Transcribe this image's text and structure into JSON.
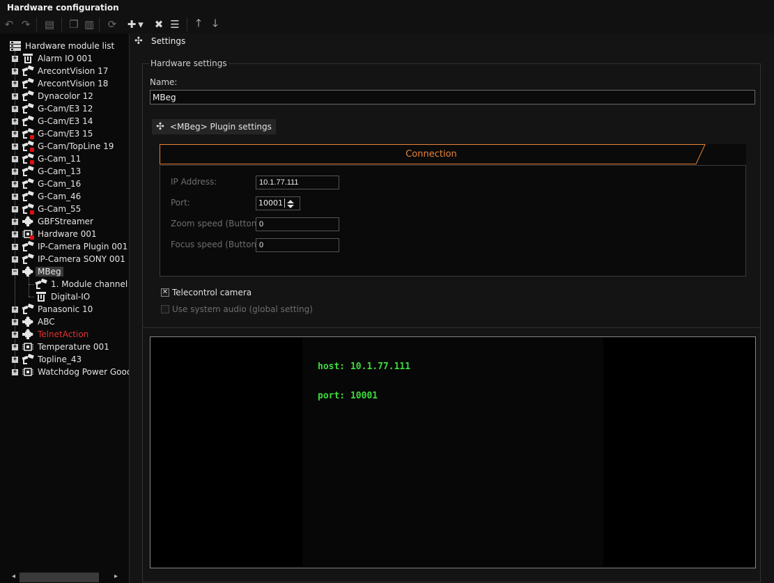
{
  "window": {
    "title": "Hardware configuration"
  },
  "toolbar": {
    "buttons": [
      {
        "icon": "undo-icon",
        "glyph": "↶"
      },
      {
        "icon": "redo-icon",
        "glyph": "↷"
      },
      {
        "icon": "print-icon",
        "glyph": "▤"
      },
      {
        "icon": "copy-icon",
        "glyph": "❐"
      },
      {
        "icon": "paste-icon",
        "glyph": "▥"
      },
      {
        "icon": "refresh-icon",
        "glyph": "⟳"
      },
      {
        "icon": "add-module-icon",
        "glyph": "✚"
      },
      {
        "icon": "dropdown-arrow-icon",
        "glyph": "▾"
      },
      {
        "icon": "delete-icon",
        "glyph": "✖"
      },
      {
        "icon": "rename-icon",
        "glyph": "☰"
      },
      {
        "icon": "move-up-icon",
        "glyph": "🡑"
      },
      {
        "icon": "move-down-icon",
        "glyph": "🡓"
      }
    ]
  },
  "tree": {
    "root_label": "Hardware module list",
    "items": [
      {
        "label": "Alarm IO 001",
        "icon": "alarm-io-icon",
        "status": "ok"
      },
      {
        "label": "ArecontVision 17",
        "icon": "camera-icon",
        "status": "ok"
      },
      {
        "label": "ArecontVision 18",
        "icon": "camera-icon",
        "status": "ok"
      },
      {
        "label": "Dynacolor 12",
        "icon": "camera-icon",
        "status": "ok"
      },
      {
        "label": "G-Cam/E3 12",
        "icon": "camera-icon",
        "status": "ok"
      },
      {
        "label": "G-Cam/E3 14",
        "icon": "camera-icon",
        "status": "ok"
      },
      {
        "label": "G-Cam/E3 15",
        "icon": "camera-icon",
        "status": "error"
      },
      {
        "label": "G-Cam/TopLine 19",
        "icon": "camera-icon",
        "status": "error"
      },
      {
        "label": "G-Cam_11",
        "icon": "camera-icon",
        "status": "error"
      },
      {
        "label": "G-Cam_13",
        "icon": "camera-icon",
        "status": "ok"
      },
      {
        "label": "G-Cam_16",
        "icon": "camera-icon",
        "status": "ok"
      },
      {
        "label": "G-Cam_46",
        "icon": "camera-icon",
        "status": "ok"
      },
      {
        "label": "G-Cam_55",
        "icon": "camera-icon",
        "status": "error"
      },
      {
        "label": "GBFStreamer",
        "icon": "plugin-icon",
        "status": "ok"
      },
      {
        "label": "Hardware 001",
        "icon": "chip-icon",
        "status": "error"
      },
      {
        "label": "IP-Camera Plugin 001",
        "icon": "camera-icon",
        "status": "ok"
      },
      {
        "label": "IP-Camera SONY 001",
        "icon": "camera-icon",
        "status": "ok"
      },
      {
        "label": "MBeg",
        "icon": "plugin-icon",
        "status": "ok",
        "selected": true,
        "expanded": true,
        "children": [
          {
            "label": "1. Module channel",
            "icon": "camera-icon"
          },
          {
            "label": "Digital-IO",
            "icon": "alarm-io-icon"
          }
        ]
      },
      {
        "label": "Panasonic 10",
        "icon": "camera-icon",
        "status": "ok"
      },
      {
        "label": "ABC",
        "icon": "plugin-icon",
        "status": "ok"
      },
      {
        "label": "TelnetAction",
        "icon": "plugin-icon",
        "status": "highlight"
      },
      {
        "label": "Temperature 001",
        "icon": "chip-icon",
        "status": "ok"
      },
      {
        "label": "Topline_43",
        "icon": "camera-icon",
        "status": "ok"
      },
      {
        "label": "Watchdog Power Good",
        "icon": "chip-icon",
        "status": "ok"
      }
    ]
  },
  "settings": {
    "header": "Settings",
    "group_title": "Hardware settings",
    "name_label": "Name:",
    "name_value": "MBeg",
    "plugin_button": "<MBeg> Plugin settings",
    "connection": {
      "tab_label": "Connection",
      "fields": {
        "ip_label": "IP Address:",
        "ip_value": "10.1.77.111",
        "port_label": "Port:",
        "port_value": "10001",
        "zoom_label": "Zoom speed (Button):",
        "zoom_value": "0",
        "focus_label": "Focus speed (Button):",
        "focus_value": "0"
      }
    },
    "telecontrol_label": "Telecontrol camera",
    "telecontrol_checked": true,
    "system_audio_label": "Use system audio (global setting)",
    "system_audio_checked": false
  },
  "console": {
    "lines": [
      "host: 10.1.77.111",
      "port: 10001"
    ]
  },
  "colors": {
    "accent": "#e8843a",
    "console_text": "#3cdc3c",
    "error_mark": "#e01010",
    "highlight_text": "#e53030"
  }
}
